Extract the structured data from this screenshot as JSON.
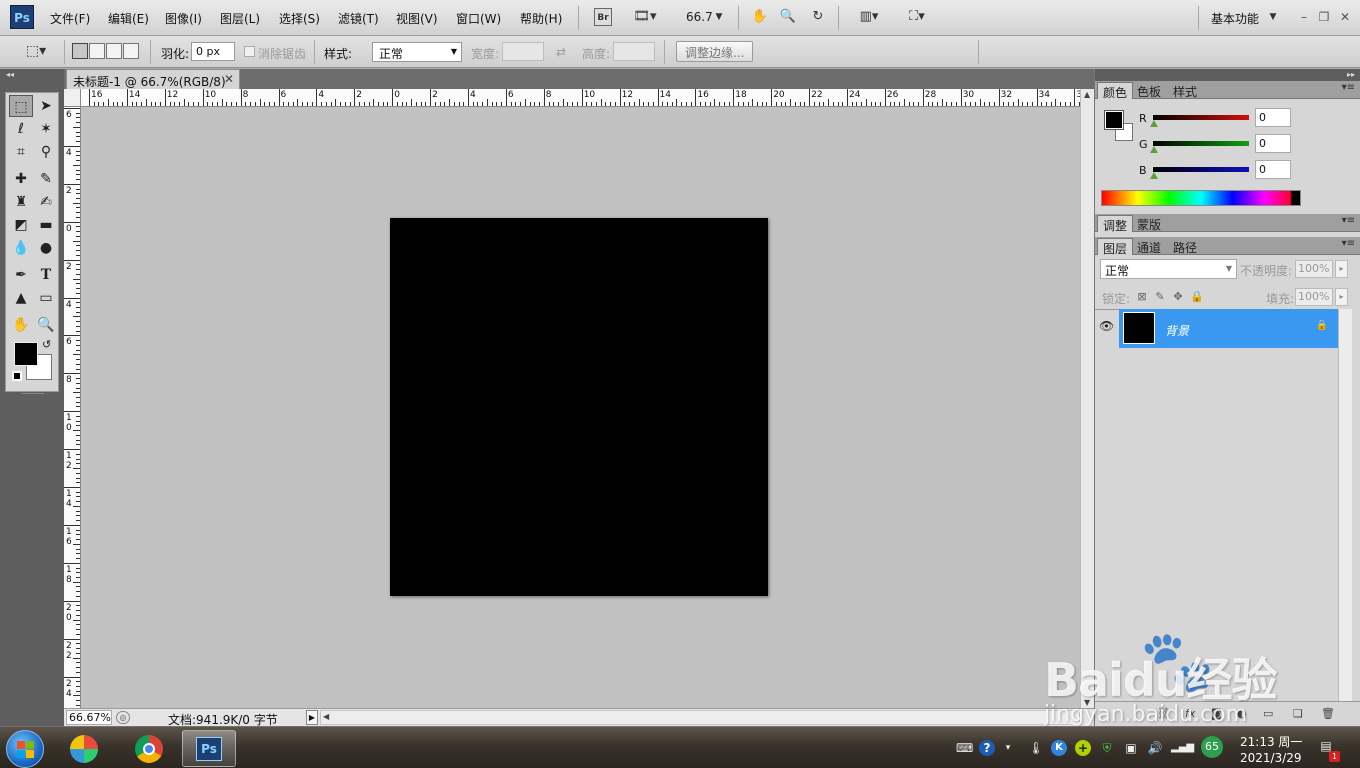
{
  "app": {
    "logo_text": "Ps"
  },
  "menu": {
    "items": [
      "文件(F)",
      "编辑(E)",
      "图像(I)",
      "图层(L)",
      "选择(S)",
      "滤镜(T)",
      "视图(V)",
      "窗口(W)",
      "帮助(H)"
    ],
    "bridge_label": "Br",
    "zoom_readout": "66.7",
    "workspace": "基本功能"
  },
  "options": {
    "feather_label": "羽化:",
    "feather_value": "0 px",
    "antialias_label": "消除锯齿",
    "style_label": "样式:",
    "style_value": "正常",
    "width_label": "宽度:",
    "height_label": "高度:",
    "refine_edge_label": "调整边缘..."
  },
  "document": {
    "tab_title": "未标题-1 @ 66.7%(RGB/8) *",
    "zoom_field": "66.67%",
    "info": "文档:941.9K/0 字节",
    "canvas_color": "#000000"
  },
  "rulers": {
    "top_labels": [
      "16",
      "14",
      "12",
      "10",
      "8",
      "6",
      "4",
      "2",
      "0",
      "2",
      "4",
      "6",
      "8",
      "10",
      "12",
      "14",
      "16",
      "18",
      "20",
      "22",
      "24",
      "26",
      "28",
      "30",
      "32",
      "34",
      "3"
    ],
    "left_labels": [
      "6",
      "4",
      "2",
      "0",
      "2",
      "4",
      "6",
      "8",
      "10",
      "12",
      "14",
      "16",
      "18",
      "20",
      "22",
      "24"
    ]
  },
  "color_panel": {
    "tabs": [
      "颜色",
      "色板",
      "样式"
    ],
    "channels": [
      {
        "name": "R",
        "value": "0",
        "color": "#d01010"
      },
      {
        "name": "G",
        "value": "0",
        "color": "#10a010"
      },
      {
        "name": "B",
        "value": "0",
        "color": "#1010c0"
      }
    ]
  },
  "adjust_panel": {
    "tabs": [
      "调整",
      "蒙版"
    ]
  },
  "layers_panel": {
    "tabs": [
      "图层",
      "通道",
      "路径"
    ],
    "blend_mode": "正常",
    "opacity_label": "不透明度:",
    "opacity_value": "100%",
    "lock_label": "锁定:",
    "fill_label": "填充:",
    "fill_value": "100%",
    "layers": [
      {
        "name": "背景",
        "visible": true,
        "locked": true,
        "selected": true
      }
    ]
  },
  "watermark": {
    "brand": "Baidu经验",
    "url": "jingyan.baidu.com"
  },
  "taskbar": {
    "active_app": "Ps",
    "tray_badge": "65",
    "time": "21:13 周一",
    "date": "2021/3/29",
    "notification_count": "1"
  }
}
